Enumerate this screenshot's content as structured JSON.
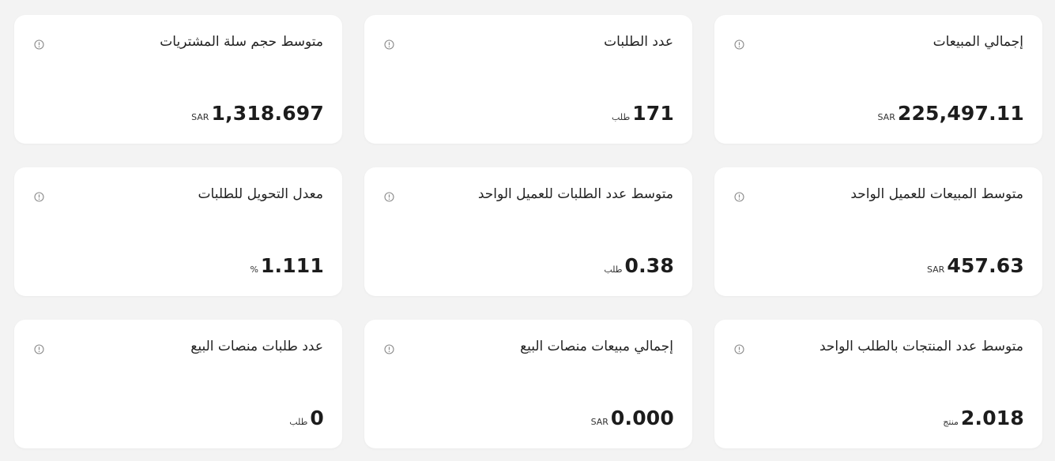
{
  "cards": [
    {
      "title": "إجمالي المبيعات",
      "value": "225,497.11",
      "unit": "SAR"
    },
    {
      "title": "عدد الطلبات",
      "value": "171",
      "unit": "طلب"
    },
    {
      "title": "متوسط حجم سلة المشتريات",
      "value": "1,318.697",
      "unit": "SAR"
    },
    {
      "title": "متوسط المبيعات للعميل الواحد",
      "value": "457.63",
      "unit": "SAR"
    },
    {
      "title": "متوسط عدد الطلبات للعميل الواحد",
      "value": "0.38",
      "unit": "طلب"
    },
    {
      "title": "معدل التحويل للطلبات",
      "value": "1.111",
      "unit": "%"
    },
    {
      "title": "متوسط عدد المنتجات بالطلب الواحد",
      "value": "2.018",
      "unit": "منتج"
    },
    {
      "title": "إجمالي مبيعات منصات البيع",
      "value": "0.000",
      "unit": "SAR"
    },
    {
      "title": "عدد طلبات منصات البيع",
      "value": "0",
      "unit": "طلب"
    }
  ],
  "icons": {
    "info": "info-icon"
  }
}
